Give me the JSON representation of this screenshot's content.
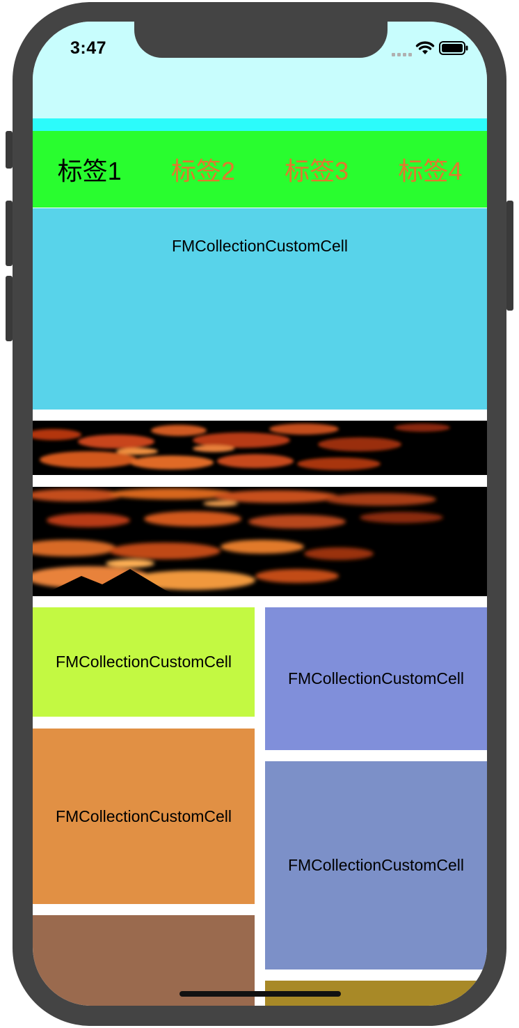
{
  "status_bar": {
    "time": "3:47"
  },
  "tabs": [
    {
      "label": "标签1",
      "selected": true,
      "color": "#000000"
    },
    {
      "label": "标签2",
      "selected": false,
      "color": "#E0792E"
    },
    {
      "label": "标签3",
      "selected": false,
      "color": "#E0792E"
    },
    {
      "label": "标签4",
      "selected": false,
      "color": "#E0792E"
    }
  ],
  "colors": {
    "header_bg": "#C8FDFD",
    "cyan_strip": "#2CFBFB",
    "tabbar_bg": "#29FD2F",
    "top_cell": "#58D3EA",
    "cell_lime": "#C3F942",
    "cell_orange": "#E19044",
    "cell_brown": "#9A6A4E",
    "cell_periwinkle": "#808FDA",
    "cell_steel": "#7C90C8",
    "cell_mustard": "#A88927"
  },
  "cells": {
    "top": "FMCollectionCustomCell",
    "left_1": "FMCollectionCustomCell",
    "left_2": "FMCollectionCustomCell",
    "right_1": "FMCollectionCustomCell",
    "right_2": "FMCollectionCustomCell"
  }
}
